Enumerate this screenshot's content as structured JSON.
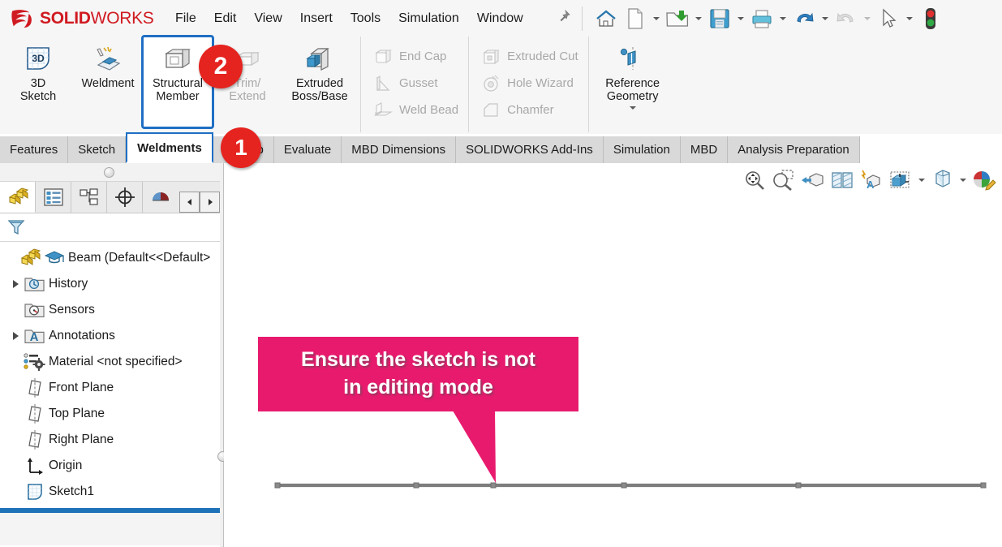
{
  "app": {
    "brand_primary": "SOLID",
    "brand_secondary": "WORKS",
    "brand_color": "#d01a21",
    "accent_blue": "#1f6fc4",
    "badge_color": "#e5231f",
    "callout_color": "#e81a6e"
  },
  "menubar": {
    "items": [
      {
        "label": "File",
        "name": "menu-file"
      },
      {
        "label": "Edit",
        "name": "menu-edit"
      },
      {
        "label": "View",
        "name": "menu-view"
      },
      {
        "label": "Insert",
        "name": "menu-insert"
      },
      {
        "label": "Tools",
        "name": "menu-tools"
      },
      {
        "label": "Simulation",
        "name": "menu-simulation"
      },
      {
        "label": "Window",
        "name": "menu-window"
      }
    ],
    "pin_icon": "pin-icon",
    "quick_access": [
      {
        "name": "home-icon",
        "label": "Home",
        "caret": false
      },
      {
        "name": "new-document-icon",
        "label": "New",
        "caret": true
      },
      {
        "name": "open-folder-icon",
        "label": "Open",
        "caret": true
      },
      {
        "name": "save-icon",
        "label": "Save",
        "caret": true
      },
      {
        "name": "print-icon",
        "label": "Print",
        "caret": true
      },
      {
        "name": "undo-icon",
        "label": "Undo",
        "caret": true
      },
      {
        "name": "redo-icon",
        "label": "Redo",
        "caret": true,
        "disabled": true
      },
      {
        "name": "select-cursor-icon",
        "label": "Select",
        "caret": true
      },
      {
        "name": "rebuild-status-icon",
        "label": "Rebuild status",
        "caret": false
      }
    ]
  },
  "ribbon": {
    "groups": [
      {
        "name": "weldment-group",
        "big": [
          {
            "label": "3D\nSketch",
            "line1": "3D",
            "line2": "Sketch",
            "icon": "3d-sketch-icon",
            "disabled": false,
            "boxed": false
          },
          {
            "label": "Weldment",
            "line1": "Weldment",
            "line2": "",
            "icon": "weldment-icon",
            "disabled": false,
            "boxed": false
          },
          {
            "label": "Structural Member",
            "line1": "Structural",
            "line2": "Member",
            "icon": "structural-member-icon",
            "disabled": false,
            "boxed": true
          },
          {
            "label": "Trim/Extend",
            "line1": "Trim/",
            "line2": "Extend",
            "icon": "trim-extend-icon",
            "disabled": true,
            "boxed": false
          },
          {
            "label": "Extruded Boss/Base",
            "line1": "Extruded",
            "line2": "Boss/Base",
            "icon": "extruded-boss-icon",
            "disabled": false,
            "boxed": false
          }
        ]
      },
      {
        "name": "weld-features-group",
        "small": [
          {
            "label": "End Cap",
            "icon": "end-cap-icon",
            "disabled": true
          },
          {
            "label": "Gusset",
            "icon": "gusset-icon",
            "disabled": true
          },
          {
            "label": "Weld Bead",
            "icon": "weld-bead-icon",
            "disabled": true
          }
        ]
      },
      {
        "name": "cut-features-group",
        "small": [
          {
            "label": "Extruded Cut",
            "icon": "extruded-cut-icon",
            "disabled": true
          },
          {
            "label": "Hole Wizard",
            "icon": "hole-wizard-icon",
            "disabled": true
          },
          {
            "label": "Chamfer",
            "icon": "chamfer-icon",
            "disabled": true
          }
        ]
      },
      {
        "name": "reference-geometry-group",
        "big": [
          {
            "label": "Reference Geometry",
            "line1": "Reference",
            "line2": "Geometry",
            "icon": "reference-geometry-icon",
            "disabled": false,
            "boxed": false,
            "dropdown": true
          }
        ]
      }
    ]
  },
  "tabs": {
    "items": [
      {
        "label": "Features",
        "name": "tab-features",
        "active": false
      },
      {
        "label": "Sketch",
        "name": "tab-sketch",
        "active": false
      },
      {
        "label": "Weldments",
        "name": "tab-weldments",
        "active": true
      },
      {
        "label": "Markup",
        "name": "tab-markup",
        "active": false
      },
      {
        "label": "Evaluate",
        "name": "tab-evaluate",
        "active": false
      },
      {
        "label": "MBD Dimensions",
        "name": "tab-mbd-dimensions",
        "active": false
      },
      {
        "label": "SOLIDWORKS Add-Ins",
        "name": "tab-solidworks-add-ins",
        "active": false
      },
      {
        "label": "Simulation",
        "name": "tab-simulation",
        "active": false
      },
      {
        "label": "MBD",
        "name": "tab-mbd",
        "active": false
      },
      {
        "label": "Analysis Preparation",
        "name": "tab-analysis-preparation",
        "active": false
      }
    ]
  },
  "left_panel": {
    "panel_tabs": [
      {
        "name": "feature-manager-tab",
        "icon": "feature-tree-icon",
        "active": true
      },
      {
        "name": "property-manager-tab",
        "icon": "property-list-icon",
        "active": false
      },
      {
        "name": "configuration-manager-tab",
        "icon": "configuration-icon",
        "active": false
      },
      {
        "name": "dimxpert-manager-tab",
        "icon": "crosshair-icon",
        "active": false
      },
      {
        "name": "display-manager-tab",
        "icon": "display-sphere-icon",
        "active": false
      }
    ],
    "nav_prev": "◀",
    "nav_next": "▶",
    "filter_icon": "filter-funnel-icon",
    "tree": [
      {
        "label": "Beam  (Default<<Default>",
        "icon": "part-icon",
        "badge_icon": "graduation-cap-icon",
        "twist": false,
        "indent": 0,
        "name": "tree-item-beam"
      },
      {
        "label": "History",
        "icon": "history-folder-icon",
        "twist": true,
        "indent": 1,
        "name": "tree-item-history"
      },
      {
        "label": "Sensors",
        "icon": "sensors-folder-icon",
        "twist": false,
        "indent": 1,
        "name": "tree-item-sensors"
      },
      {
        "label": "Annotations",
        "icon": "annotations-folder-icon",
        "twist": true,
        "indent": 1,
        "name": "tree-item-annotations"
      },
      {
        "label": "Material <not specified>",
        "icon": "material-icon",
        "twist": false,
        "indent": 1,
        "name": "tree-item-material"
      },
      {
        "label": "Front Plane",
        "icon": "plane-icon",
        "twist": false,
        "indent": 1,
        "name": "tree-item-front-plane"
      },
      {
        "label": "Top Plane",
        "icon": "plane-icon",
        "twist": false,
        "indent": 1,
        "name": "tree-item-top-plane"
      },
      {
        "label": "Right Plane",
        "icon": "plane-icon",
        "twist": false,
        "indent": 1,
        "name": "tree-item-right-plane"
      },
      {
        "label": "Origin",
        "icon": "origin-axis-icon",
        "twist": false,
        "indent": 1,
        "name": "tree-item-origin"
      },
      {
        "label": "Sketch1",
        "icon": "sketch-icon",
        "twist": false,
        "indent": 1,
        "name": "tree-item-sketch1"
      }
    ]
  },
  "view_toolbar": [
    {
      "name": "zoom-to-fit-icon",
      "caret": false
    },
    {
      "name": "zoom-to-area-icon",
      "caret": false
    },
    {
      "name": "previous-view-icon",
      "caret": false
    },
    {
      "name": "section-view-icon",
      "caret": false
    },
    {
      "name": "view-orientation-icon",
      "caret": false
    },
    {
      "name": "display-style-icon",
      "caret": true
    },
    {
      "name": "hide-show-items-icon",
      "caret": true
    },
    {
      "name": "edit-appearance-icon",
      "caret": false
    }
  ],
  "callout": {
    "line1": "Ensure the sketch is not",
    "line2": "in editing mode"
  },
  "badges": {
    "step1": "1",
    "step2": "2"
  },
  "sketch_graphic": {
    "name": "sketch-line",
    "vertex_count": 6
  }
}
